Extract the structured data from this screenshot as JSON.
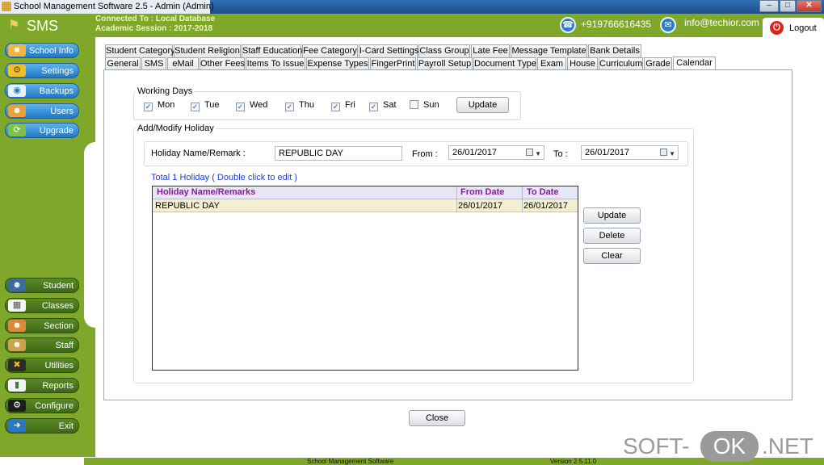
{
  "window": {
    "title": "School Management Software 2.5  -  Admin (Admin)",
    "minimize": "–",
    "maximize": "□",
    "close": "✕"
  },
  "header": {
    "logo": "SMS",
    "connection": "Connected To : Local Database",
    "session": "Academic Session : 2017-2018",
    "phone": "+919766616435",
    "email": "info@techior.com",
    "logout": "Logout",
    "accent_color": "#7fa82b"
  },
  "sidebar": {
    "top_items": [
      {
        "label": "School Info",
        "icon": "school-icon"
      },
      {
        "label": "Settings",
        "icon": "gear-icon"
      },
      {
        "label": "Backups",
        "icon": "disk-icon"
      },
      {
        "label": "Users",
        "icon": "users-icon"
      },
      {
        "label": "Upgrade",
        "icon": "upgrade-icon"
      }
    ],
    "bottom_items": [
      {
        "label": "Student",
        "icon": "student-icon"
      },
      {
        "label": "Classes",
        "icon": "classes-icon"
      },
      {
        "label": "Section",
        "icon": "section-icon"
      },
      {
        "label": "Staff",
        "icon": "staff-icon"
      },
      {
        "label": "Utilities",
        "icon": "tools-icon"
      },
      {
        "label": "Reports",
        "icon": "chart-icon"
      },
      {
        "label": "Configure",
        "icon": "configure-gear-icon"
      },
      {
        "label": "Exit",
        "icon": "exit-icon"
      }
    ]
  },
  "tabs": {
    "row1": [
      "Student Category",
      "Student Religion",
      "Staff Education",
      "Fee Category",
      "I-Card Settings",
      "Class Group",
      "Late Fee",
      "Message Template",
      "Bank Details"
    ],
    "row2": [
      "General",
      "SMS",
      "eMail",
      "Other Fees",
      "Items To Issue",
      "Expense Types",
      "FingerPrint",
      "Payroll Setup",
      "Document Type",
      "Exam",
      "House",
      "Curriculum",
      "Grade",
      "Calendar"
    ],
    "active": "Calendar"
  },
  "working_days": {
    "title": "Working Days",
    "days": [
      {
        "label": "Mon",
        "checked": true
      },
      {
        "label": "Tue",
        "checked": true
      },
      {
        "label": "Wed",
        "checked": true
      },
      {
        "label": "Thu",
        "checked": true
      },
      {
        "label": "Fri",
        "checked": true
      },
      {
        "label": "Sat",
        "checked": true
      },
      {
        "label": "Sun",
        "checked": false
      }
    ],
    "update_button": "Update"
  },
  "holiday": {
    "title": "Add/Modify Holiday",
    "name_label": "Holiday Name/Remark :",
    "name_value": "REPUBLIC DAY",
    "from_label": "From :",
    "from_value": "26/01/2017",
    "to_label": "To :",
    "to_value": "26/01/2017",
    "total_text": "Total 1 Holiday ( Double click to edit )",
    "columns": [
      "Holiday Name/Remarks",
      "From Date",
      "To Date"
    ],
    "rows": [
      [
        "REPUBLIC DAY",
        "26/01/2017",
        "26/01/2017"
      ]
    ],
    "update_button": "Update",
    "delete_button": "Delete",
    "clear_button": "Clear"
  },
  "close_button": "Close",
  "footer": {
    "name": "School Management Software",
    "version": "Version 2.5.11.0"
  },
  "watermark": {
    "part1": "SOFT-",
    "part2": "OK",
    "part3": ".NET"
  }
}
